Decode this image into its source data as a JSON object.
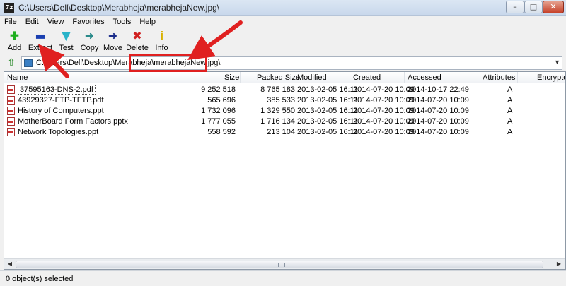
{
  "window": {
    "title": "C:\\Users\\Dell\\Desktop\\Merabheja\\merabhejaNew.jpg\\",
    "app_icon_text": "7z",
    "min_glyph": "–",
    "max_glyph": "□",
    "close_glyph": "✕"
  },
  "menu": [
    "File",
    "Edit",
    "View",
    "Favorites",
    "Tools",
    "Help"
  ],
  "toolbar": {
    "add": {
      "label": "Add",
      "glyph": "✚",
      "color": "#1fae1f",
      "icon": "plus-icon"
    },
    "extract": {
      "label": "Extract",
      "glyph": "▬",
      "color": "#1a3fb0",
      "icon": "minus-icon"
    },
    "test": {
      "label": "Test",
      "glyph": "▼",
      "color": "#29b3c9",
      "icon": "check-arrow-icon"
    },
    "copy": {
      "label": "Copy",
      "glyph": "➜",
      "color": "#2a8a8a",
      "icon": "copy-arrow-icon"
    },
    "move": {
      "label": "Move",
      "glyph": "➜",
      "color": "#1a2c8a",
      "icon": "move-arrow-icon"
    },
    "delete": {
      "label": "Delete",
      "glyph": "✖",
      "color": "#d01f1f",
      "icon": "delete-x-icon"
    },
    "info": {
      "label": "Info",
      "glyph": "i",
      "color": "#d8b100",
      "icon": "info-icon"
    }
  },
  "address": {
    "path": "C:\\Users\\Dell\\Desktop\\Merabheja\\merabhejaNew.jpg\\",
    "up_glyph": "⇧",
    "drop_glyph": "▼"
  },
  "columns": {
    "name": "Name",
    "size": "Size",
    "packed": "Packed Size",
    "modified": "Modified",
    "created": "Created",
    "accessed": "Accessed",
    "attributes": "Attributes",
    "encrypted": "Encrypte"
  },
  "files": [
    {
      "name": "37595163-DNS-2.pdf",
      "size": "9 252 518",
      "packed": "8 765 183",
      "modified": "2013-02-05 16:11",
      "created": "2014-07-20 10:09",
      "accessed": "2014-10-17 22:49",
      "attr": "A"
    },
    {
      "name": "43929327-FTP-TFTP.pdf",
      "size": "565 696",
      "packed": "385 533",
      "modified": "2013-02-05 16:11",
      "created": "2014-07-20 10:09",
      "accessed": "2014-07-20 10:09",
      "attr": "A"
    },
    {
      "name": "History of Computers.ppt",
      "size": "1 732 096",
      "packed": "1 329 550",
      "modified": "2013-02-05 16:11",
      "created": "2014-07-20 10:09",
      "accessed": "2014-07-20 10:09",
      "attr": "A"
    },
    {
      "name": "MotherBoard Form Factors.pptx",
      "size": "1 777 055",
      "packed": "1 716 134",
      "modified": "2013-02-05 16:11",
      "created": "2014-07-20 10:09",
      "accessed": "2014-07-20 10:09",
      "attr": "A"
    },
    {
      "name": "Network Topologies.ppt",
      "size": "558 592",
      "packed": "213 104",
      "modified": "2013-02-05 16:11",
      "created": "2014-07-20 10:09",
      "accessed": "2014-07-20 10:09",
      "attr": "A"
    }
  ],
  "scrollbar": {
    "left_glyph": "◀",
    "right_glyph": "▶"
  },
  "status": {
    "text": "0 object(s) selected"
  },
  "annotation": {
    "color": "#e02020"
  }
}
